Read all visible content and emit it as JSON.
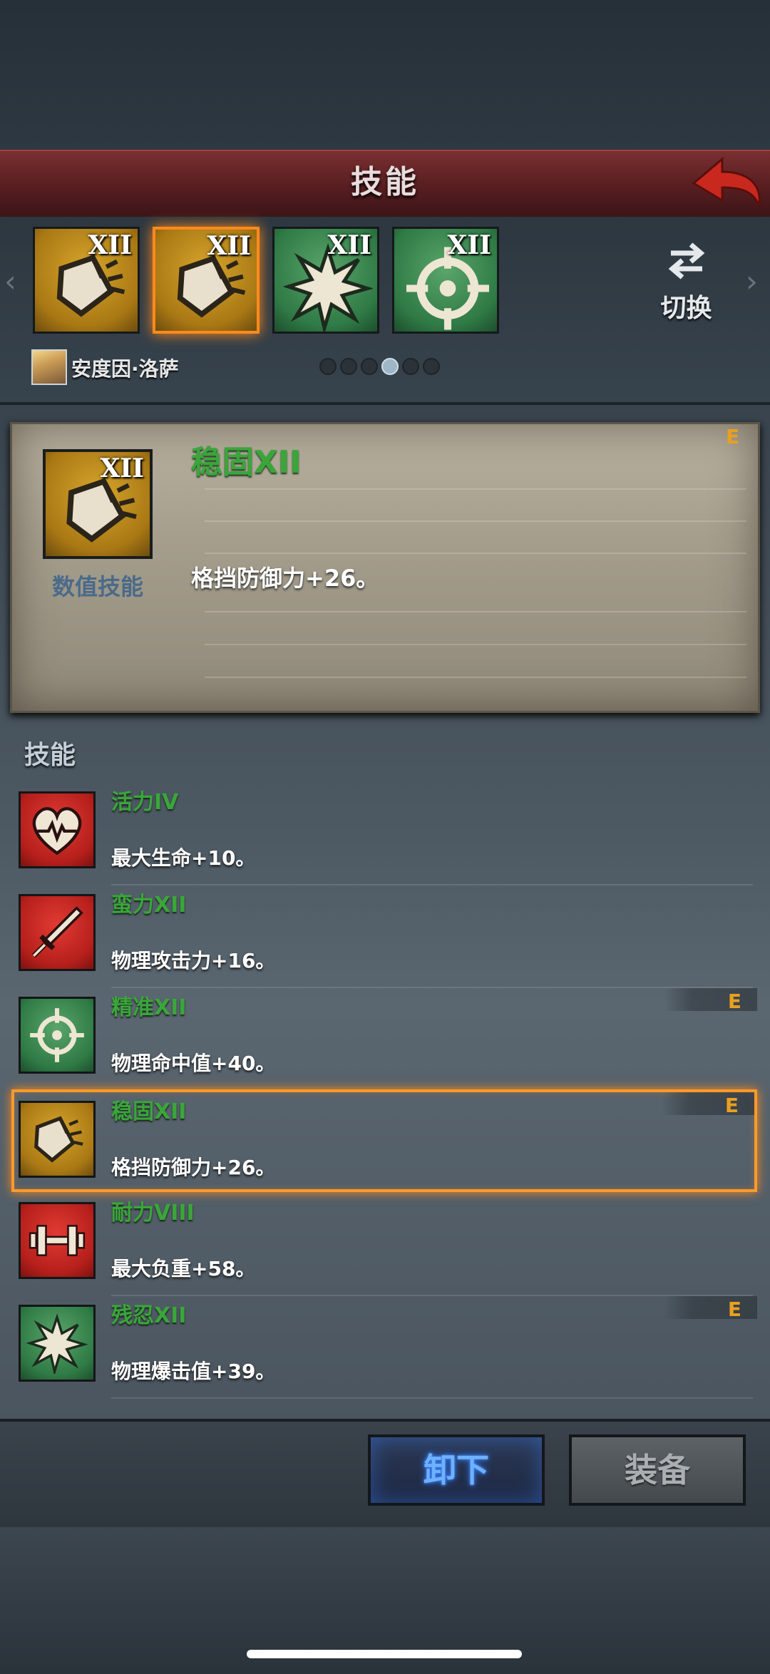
{
  "header": {
    "title": "技能"
  },
  "equipped_slots": [
    {
      "level": "XII",
      "icon": "shield-broken-icon",
      "tier": "gold",
      "selected": false
    },
    {
      "level": "XII",
      "icon": "shield-broken-icon",
      "tier": "gold",
      "selected": true
    },
    {
      "level": "XII",
      "icon": "burst-star-icon",
      "tier": "green",
      "selected": false
    },
    {
      "level": "XII",
      "icon": "crosshair-icon",
      "tier": "green",
      "selected": false
    }
  ],
  "swap": {
    "label": "切换",
    "icon": "swap-arrows-icon"
  },
  "hero": {
    "name": "安度因·洛萨"
  },
  "pager": {
    "total": 6,
    "active_index": 3
  },
  "detail": {
    "name": "稳固XII",
    "type": "数值技能",
    "description": "格挡防御力+26。",
    "grade": "E",
    "icon": "shield-broken-icon"
  },
  "skills_heading": "技能",
  "skills": [
    {
      "name": "活力IV",
      "desc": "最大生命+10。",
      "grade": "",
      "icon": "heart-pulse-icon",
      "tier": "red"
    },
    {
      "name": "蛮力XII",
      "desc": "物理攻击力+16。",
      "grade": "",
      "icon": "sword-icon",
      "tier": "red"
    },
    {
      "name": "精准XII",
      "desc": "物理命中值+40。",
      "grade": "E",
      "icon": "crosshair-icon",
      "tier": "green"
    },
    {
      "name": "稳固XII",
      "desc": "格挡防御力+26。",
      "grade": "E",
      "icon": "shield-broken-icon",
      "tier": "gold",
      "selected": true
    },
    {
      "name": "耐力VIII",
      "desc": "最大负重+58。",
      "grade": "",
      "icon": "dumbbell-icon",
      "tier": "red"
    },
    {
      "name": "残忍XII",
      "desc": "物理爆击值+39。",
      "grade": "E",
      "icon": "burst-star-icon",
      "tier": "green"
    }
  ],
  "buttons": {
    "unequip": "卸下",
    "equip": "装备"
  },
  "colors": {
    "accent_orange": "#ff8a1c",
    "skill_name_green": "#3aa63a",
    "grade_orange": "#e8a020",
    "header_red": "#5a1f22"
  }
}
